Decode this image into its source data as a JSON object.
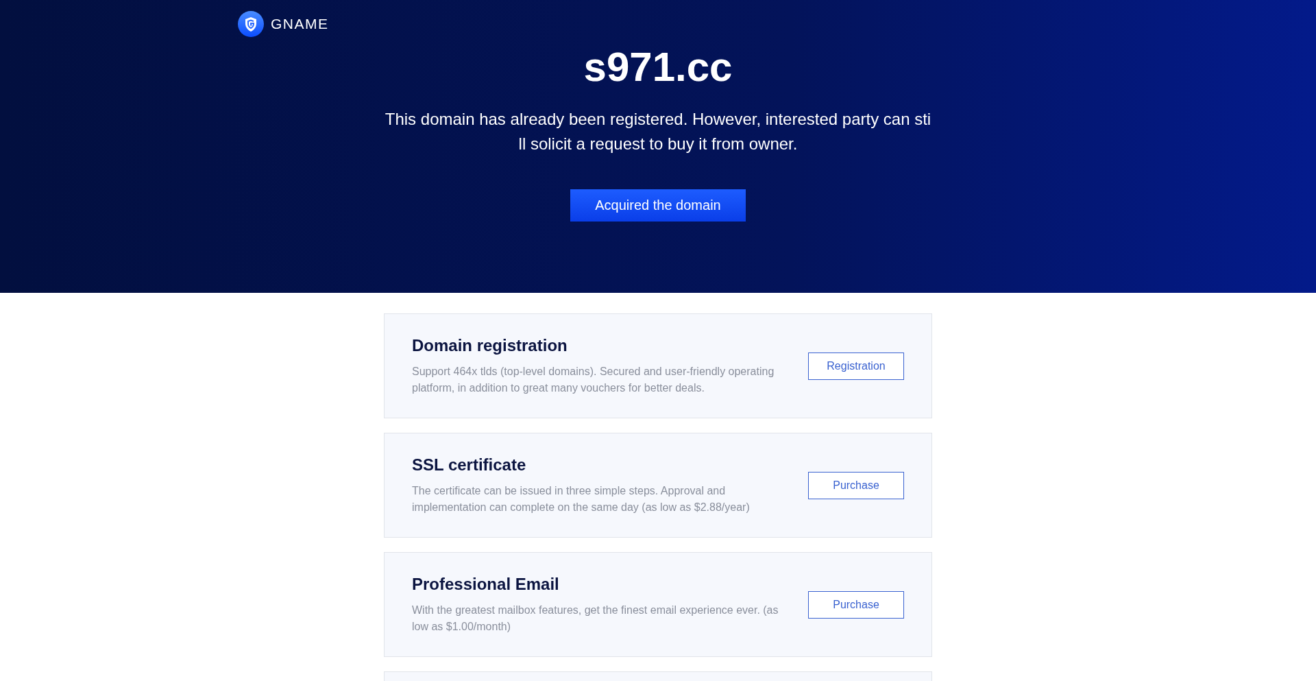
{
  "brand": {
    "name": "GNAME"
  },
  "hero": {
    "domain": "s971.cc",
    "message": "This domain has already been registered. However, interested party can still solicit a request to buy it from owner.",
    "button": "Acquired the domain"
  },
  "services": [
    {
      "title": "Domain registration",
      "description": "Support 464x tlds (top-level domains). Secured and user-friendly operating platform, in addition to great many vouchers for better deals.",
      "button": "Registration"
    },
    {
      "title": "SSL certificate",
      "description": "The certificate can be issued in three simple steps. Approval and implementation can complete on the same day (as low as $2.88/year)",
      "button": "Purchase"
    },
    {
      "title": "Professional Email",
      "description": "With the greatest mailbox features, get the finest email experience ever. (as low as $1.00/month)",
      "button": "Purchase"
    }
  ]
}
